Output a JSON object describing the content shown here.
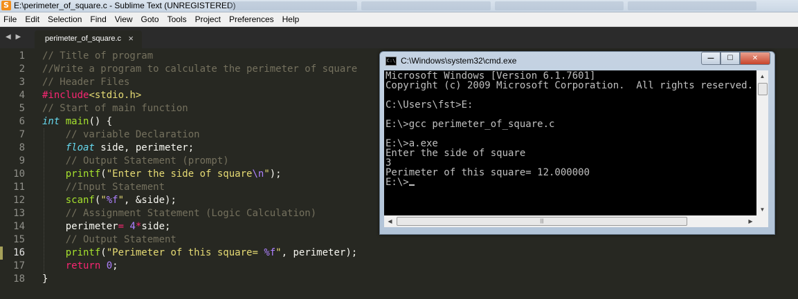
{
  "window": {
    "title": "E:\\perimeter_of_square.c - Sublime Text (UNREGISTERED)",
    "app_icon": "sublime-text-icon"
  },
  "menu": [
    "File",
    "Edit",
    "Selection",
    "Find",
    "View",
    "Goto",
    "Tools",
    "Project",
    "Preferences",
    "Help"
  ],
  "tab": {
    "label": "perimeter_of_square.c",
    "close": "×",
    "nav": "◀ ▶"
  },
  "editor": {
    "active_line": 16,
    "line_numbers": [
      "1",
      "2",
      "3",
      "4",
      "5",
      "6",
      "7",
      "8",
      "9",
      "10",
      "11",
      "12",
      "13",
      "14",
      "15",
      "16",
      "17",
      "18"
    ],
    "code": {
      "l1": "// Title of program",
      "l2": "//Write a program to calculate the perimeter of square",
      "l3": "// Header Files",
      "l4_kw": "#include",
      "l4_hdr": "<stdio.h>",
      "l5": "// Start of main function",
      "l6_type": "int",
      "l6_fn": "main",
      "l6_rest": "() {",
      "l7": "// variable Declaration",
      "l8_type": "float",
      "l8_rest": " side, perimeter;",
      "l9": "// Output Statement (prompt)",
      "l10_fn": "printf",
      "l10_open": "(",
      "l10_str": "\"Enter the side of square",
      "l10_esc": "\\n",
      "l10_str2": "\"",
      "l10_close": ");",
      "l11": "//Input Statement",
      "l12_fn": "scanf",
      "l12_open": "(",
      "l12_str": "\"",
      "l12_fmt": "%f",
      "l12_str2": "\"",
      "l12_rest": ", &side);",
      "l13": "// Assignment Statement (Logic Calculation)",
      "l14_a": "perimeter",
      "l14_op1": "=",
      "l14_sp": " ",
      "l14_num": "4",
      "l14_op2": "*",
      "l14_b": "side;",
      "l15": "// Output Statement",
      "l16_fn": "printf",
      "l16_open": "(",
      "l16_str": "\"Perimeter of this square= ",
      "l16_fmt": "%f",
      "l16_str2": "\"",
      "l16_rest": ", perimeter);",
      "l17_kw": "return",
      "l17_sp": " ",
      "l17_num": "0",
      "l17_semi": ";",
      "l18": "}"
    }
  },
  "cmd": {
    "title": "C:\\Windows\\system32\\cmd.exe",
    "icon_text": "C:\\",
    "buttons": {
      "minimize": "—",
      "maximize": "☐",
      "close": "✕"
    },
    "lines": [
      "Microsoft Windows [Version 6.1.7601]",
      "Copyright (c) 2009 Microsoft Corporation.  All rights reserved.",
      "",
      "C:\\Users\\fst>E:",
      "",
      "E:\\>gcc perimeter_of_square.c",
      "",
      "E:\\>a.exe",
      "Enter the side of square",
      "3",
      "Perimeter of this square= 12.000000",
      "E:\\>"
    ]
  },
  "colors": {
    "editor_bg": "#272822",
    "comment": "#75715e",
    "keyword": "#f92672",
    "type": "#66d9ef",
    "function": "#a6e22e",
    "string": "#e6db74",
    "number": "#ae81ff",
    "console_bg": "#000000",
    "console_text": "#c0c0c0"
  }
}
